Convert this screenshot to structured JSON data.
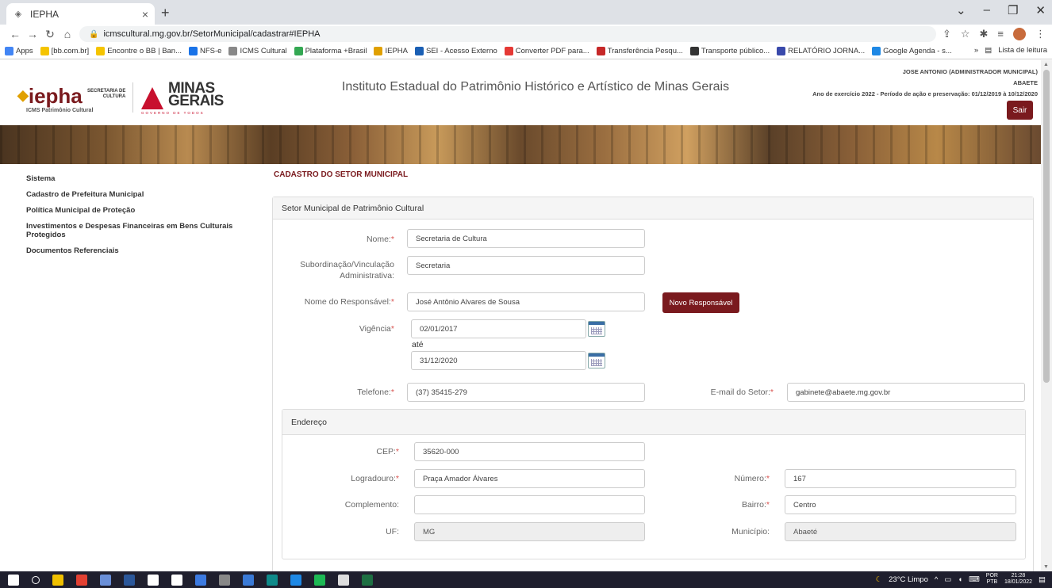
{
  "browser": {
    "tab_title": "IEPHA",
    "tab_close": "×",
    "new_tab": "+",
    "url": "icmscultural.mg.gov.br/SetorMunicipal/cadastrar#IEPHA",
    "bookmarks": [
      {
        "label": "Apps",
        "color": "#4285f4"
      },
      {
        "label": "[bb.com.br]",
        "color": "#f5c400"
      },
      {
        "label": "Encontre o BB | Ban...",
        "color": "#f5c400"
      },
      {
        "label": "NFS-e",
        "color": "#1a73e8"
      },
      {
        "label": "ICMS Cultural",
        "color": "#888888"
      },
      {
        "label": "Plataforma +Brasil",
        "color": "#34a853"
      },
      {
        "label": "IEPHA",
        "color": "#e0a000"
      },
      {
        "label": "SEI - Acesso Externo",
        "color": "#1a5fb4"
      },
      {
        "label": "Converter PDF para...",
        "color": "#e53935"
      },
      {
        "label": "Transferência Pesqu...",
        "color": "#c62828"
      },
      {
        "label": "Transporte público...",
        "color": "#333333"
      },
      {
        "label": "RELATÓRIO JORNA...",
        "color": "#3949ab"
      },
      {
        "label": "Google Agenda - s...",
        "color": "#1e88e5"
      }
    ],
    "reading_list": "Lista de leitura",
    "more_bookmarks": "»"
  },
  "header": {
    "logo_text": "iepha",
    "logo_diamond": "◆",
    "logo_sub": "ICMS Patrimônio Cultural",
    "secretaria": "SECRETARIA DE",
    "cultura": "CULTURA",
    "minas_line1": "MINAS",
    "minas_line2": "GERAIS",
    "governo": "GOVERNO DE TODOS",
    "institute_title": "Instituto Estadual do Patrimônio Histórico e Artístico de Minas Gerais",
    "user_name": "JOSE ANTONIO  (ADMINISTRADOR MUNICIPAL)",
    "city": "ABAETE",
    "exercise": "Ano de exercício 2022 - Período de ação e preservação: 01/12/2019 à 10/12/2020",
    "logout": "Sair"
  },
  "sidebar": {
    "items": [
      {
        "label": "Sistema"
      },
      {
        "label": "Cadastro de Prefeitura Municipal"
      },
      {
        "label": "Política Municipal de Proteção"
      },
      {
        "label": "Investimentos e Despesas Financeiras em Bens Culturais Protegidos"
      },
      {
        "label": "Documentos Referenciais"
      }
    ]
  },
  "main": {
    "section_title": "CADASTRO DO SETOR MUNICIPAL",
    "panel_title": "Setor Municipal de Patrimônio Cultural",
    "required_mark": "*",
    "fields": {
      "nome": {
        "label": "Nome:",
        "value": "Secretaria de Cultura"
      },
      "subordinacao": {
        "label": "Subordinação/Vinculação Administrativa:",
        "value": "Secretaria"
      },
      "responsavel": {
        "label": "Nome do Responsável:",
        "value": "José Antônio Alvares de Sousa"
      },
      "vigencia": {
        "label": "Vigência",
        "start": "02/01/2017",
        "until": "até",
        "end": "31/12/2020"
      },
      "telefone": {
        "label": "Telefone:",
        "value": "(37) 35415-279"
      },
      "email": {
        "label": "E-mail do Setor:",
        "value": "gabinete@abaete.mg.gov.br"
      }
    },
    "novo_responsavel": "Novo Responsável",
    "endereco": {
      "title": "Endereço",
      "cep": {
        "label": "CEP:",
        "value": "35620-000"
      },
      "logradouro": {
        "label": "Logradouro:",
        "value": "Praça Amador Álvares"
      },
      "numero": {
        "label": "Número:",
        "value": "167"
      },
      "complemento": {
        "label": "Complemento:",
        "value": ""
      },
      "bairro": {
        "label": "Bairro:",
        "value": "Centro"
      },
      "uf": {
        "label": "UF:",
        "value": "MG"
      },
      "municipio": {
        "label": "Município:",
        "value": "Abaeté"
      }
    }
  },
  "taskbar": {
    "weather": "23°C  Limpo",
    "lang": "POR",
    "layout": "PTB",
    "time": "21:28",
    "date": "18/01/2022",
    "icon_colors": [
      "#ffffff",
      "#ffffff",
      "#f0c000",
      "#e34133",
      "#6a8fd8",
      "#2b579a",
      "#ffffff",
      "#ffffff",
      "#3c7ae0",
      "#888888",
      "#3a7ad6",
      "#0f8a8a",
      "#1e88e5",
      "#1db954",
      "#dddddd",
      "#1d6f42"
    ]
  },
  "colors": {
    "accent": "#7a1a1e",
    "required": "#d9534f"
  }
}
